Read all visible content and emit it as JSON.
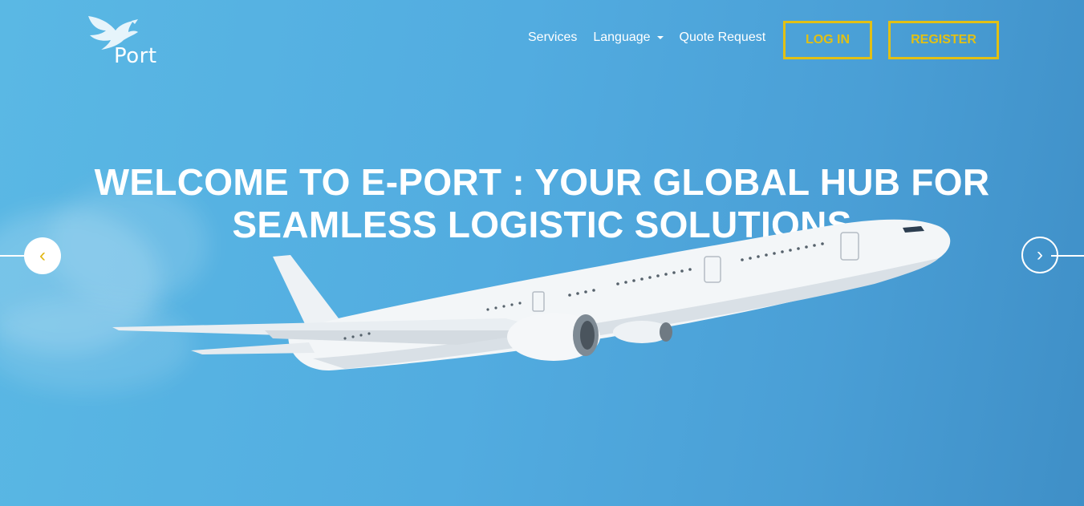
{
  "brand": {
    "logo_text": "Port"
  },
  "nav": {
    "services": "Services",
    "language": "Language",
    "quote_request": "Quote Request",
    "login": "LOG IN",
    "register": "REGISTER"
  },
  "hero": {
    "title_line1": "WELCOME TO E-PORT : YOUR GLOBAL HUB FOR",
    "title_line2": "SEAMLESS LOGISTIC SOLUTIONS"
  },
  "carousel": {
    "prev_glyph": "‹",
    "next_glyph": "›"
  },
  "icons": {
    "logo": "eagle-logo-icon",
    "language_caret": "caret-down-icon",
    "hero_image": "airplane-image"
  },
  "colors": {
    "accent": "#e2c014",
    "sky": "#52ace0",
    "text": "#ffffff"
  }
}
